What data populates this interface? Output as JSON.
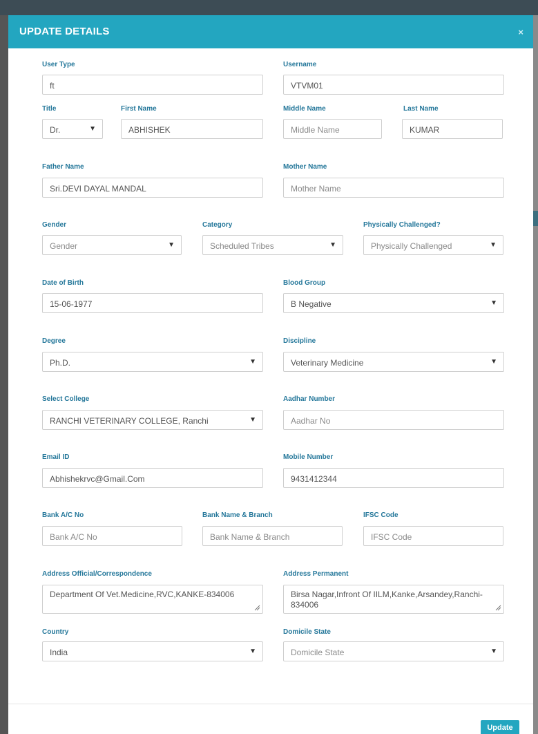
{
  "modal": {
    "title": "UPDATE DETAILS",
    "close": "×"
  },
  "form": {
    "user_type": {
      "label": "User Type",
      "value": "ft"
    },
    "username": {
      "label": "Username",
      "value": "VTVM01"
    },
    "title": {
      "label": "Title",
      "value": "Dr."
    },
    "first_name": {
      "label": "First Name",
      "value": "ABHISHEK"
    },
    "middle_name": {
      "label": "Middle Name",
      "placeholder": "Middle Name"
    },
    "last_name": {
      "label": "Last Name",
      "value": "KUMAR"
    },
    "father_name": {
      "label": "Father Name",
      "value": "Sri.DEVI DAYAL MANDAL"
    },
    "mother_name": {
      "label": "Mother Name",
      "placeholder": "Mother Name"
    },
    "gender": {
      "label": "Gender",
      "value": "Gender"
    },
    "category": {
      "label": "Category",
      "value": "Scheduled Tribes"
    },
    "physically_challenged": {
      "label": "Physically Challenged?",
      "value": "Physically Challenged"
    },
    "dob": {
      "label": "Date of Birth",
      "value": "15-06-1977"
    },
    "blood_group": {
      "label": "Blood Group",
      "value": "B Negative"
    },
    "degree": {
      "label": "Degree",
      "value": "Ph.D."
    },
    "discipline": {
      "label": "Discipline",
      "value": "Veterinary Medicine"
    },
    "college": {
      "label": "Select College",
      "value": "RANCHI VETERINARY COLLEGE, Ranchi"
    },
    "aadhar": {
      "label": "Aadhar Number",
      "placeholder": "Aadhar No"
    },
    "email": {
      "label": "Email ID",
      "value": "Abhishekrvc@Gmail.Com"
    },
    "mobile": {
      "label": "Mobile Number",
      "value": "9431412344"
    },
    "bank_ac": {
      "label": "Bank A/C No",
      "placeholder": "Bank A/C No"
    },
    "bank_name": {
      "label": "Bank Name & Branch",
      "placeholder": "Bank Name & Branch"
    },
    "ifsc": {
      "label": "IFSC Code",
      "placeholder": "IFSC Code"
    },
    "address_official": {
      "label": "Address Official/Correspondence",
      "value": "Department Of Vet.Medicine,RVC,KANKE-834006"
    },
    "address_permanent": {
      "label": "Address Permanent",
      "value": "Birsa Nagar,Infront Of IILM,Kanke,Arsandey,Ranchi-834006"
    },
    "country": {
      "label": "Country",
      "value": "India"
    },
    "domicile_state": {
      "label": "Domicile State",
      "value": "Domicile State"
    }
  },
  "footer": {
    "update_label": "Update"
  },
  "icons": {
    "close": "close-icon",
    "dropdown": "chevron-down-icon",
    "resize": "resize-grip-icon"
  },
  "colors": {
    "accent": "#23a6c0",
    "label": "#24779a"
  }
}
